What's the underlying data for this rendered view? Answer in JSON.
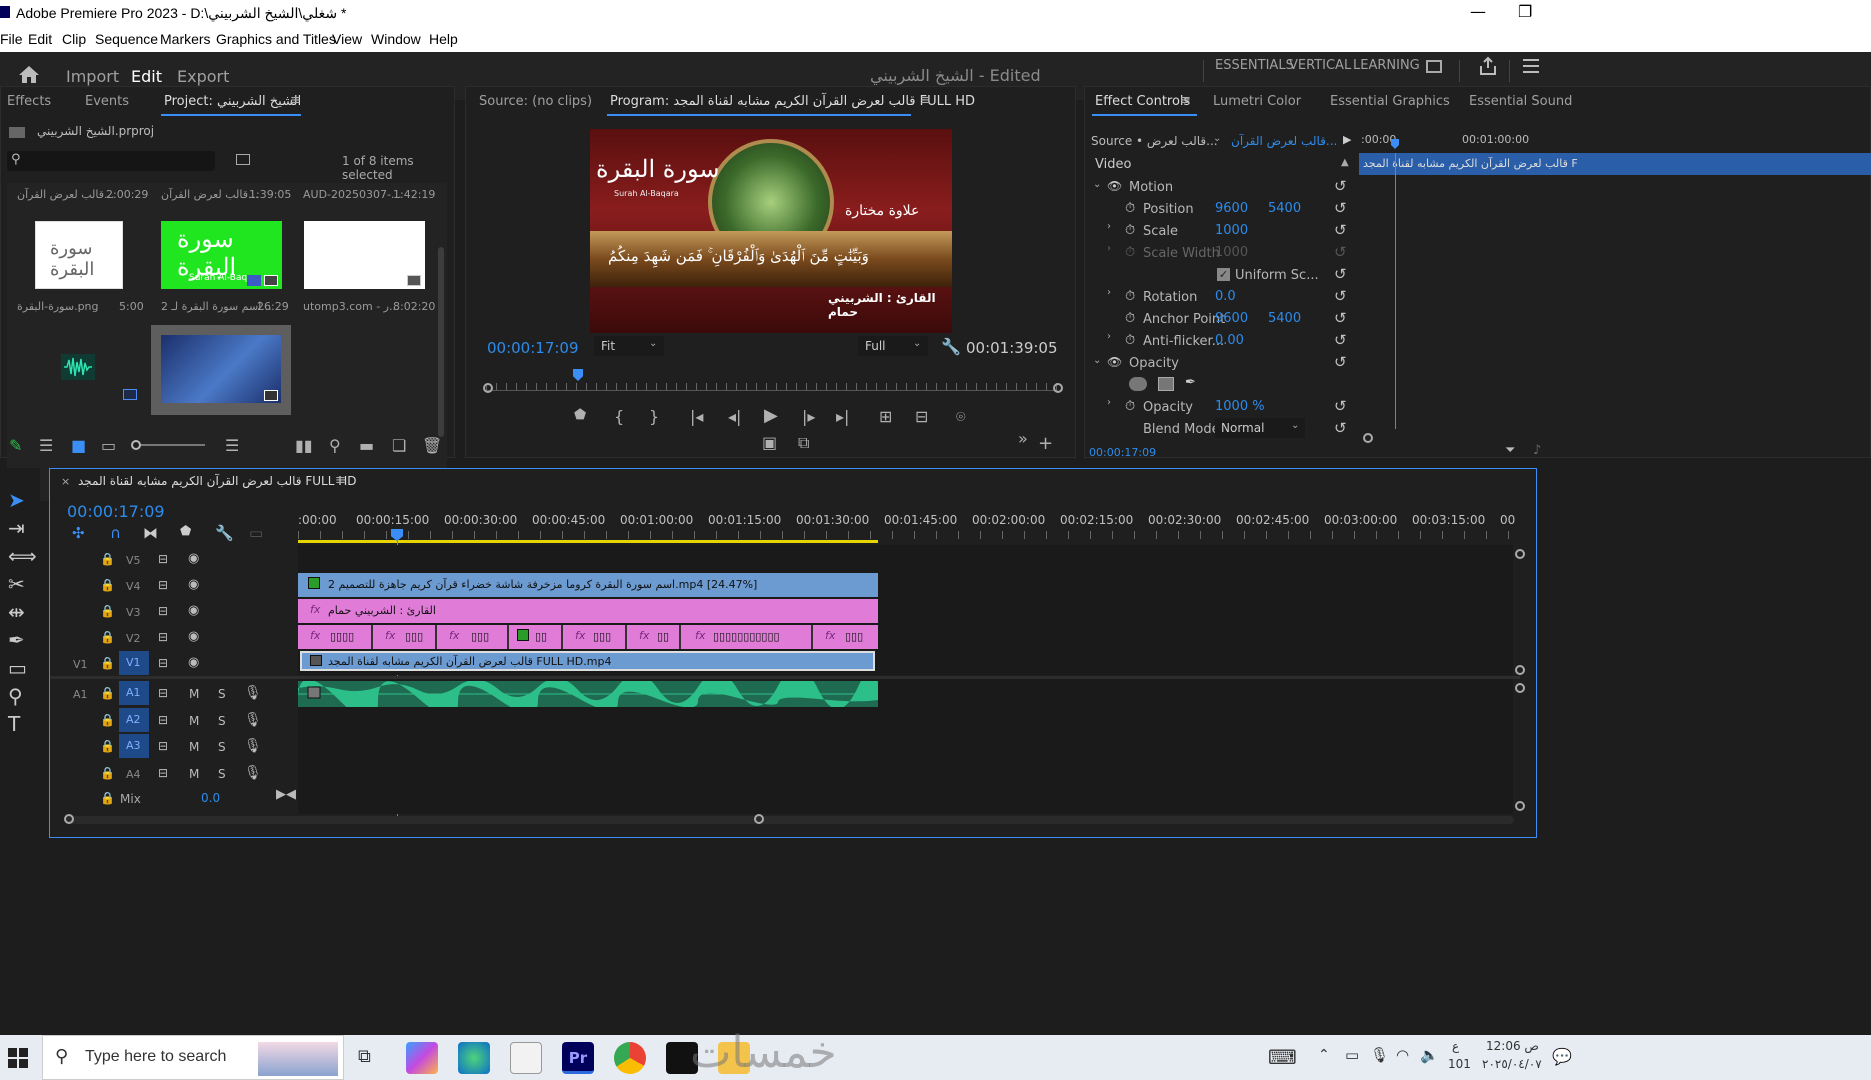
{
  "window": {
    "title": "Adobe Premiere Pro 2023 - D:\\شغلي\\الشيخ الشربيني *",
    "controls": [
      "—",
      "❐"
    ]
  },
  "menu": [
    "File",
    "Edit",
    "Clip",
    "Sequence",
    "Markers",
    "Graphics and Titles",
    "View",
    "Window",
    "Help"
  ],
  "header": {
    "modes": [
      "Import",
      "Edit",
      "Export"
    ],
    "active_mode": "Edit",
    "project_title": "الشيخ الشربيني - Edited",
    "workspaces": [
      "ESSENTIALS",
      "VERTICAL",
      "LEARNING"
    ]
  },
  "project_panel": {
    "tabs": [
      "Effects",
      "Events",
      "Project: الشيخ الشربيني"
    ],
    "file_name": "الشيخ الشربيني.prproj",
    "selection_status": "1 of 8 items selected",
    "items": [
      {
        "name": "قالب لعرض القرآن...",
        "duration": "2:00:29"
      },
      {
        "name": "قالب لعرض القرآن...",
        "duration": "1:39:05"
      },
      {
        "name": "AUD-20250307-...",
        "duration": "1:42:19"
      },
      {
        "name": "سورة-البقرة.png",
        "duration": "5:00"
      },
      {
        "name": "اسم سورة البقرة لـ 2...",
        "duration": "26:29"
      },
      {
        "name": "utomp3.com - ر...",
        "duration": "8:02:20"
      },
      {
        "name": "",
        "duration": ""
      },
      {
        "name": "",
        "duration": ""
      }
    ],
    "thumb_texts": {
      "surah_title": "سورة البقرة",
      "surah_sub": "Surah Al-Baqara"
    }
  },
  "program_monitor": {
    "source_tab": "Source: (no clips)",
    "program_tab": "Program: قالب لعرض القرآن الكريم مشابه لقناة المجد FULL HD",
    "current_time": "00:00:17:09",
    "fit": "Fit",
    "quality": "Full",
    "duration": "00:01:39:05",
    "frame": {
      "surah_title": "سورة البقرة",
      "surah_sub": "Surah Al-Baqara",
      "ayah": "وَبَيِّنَٰتٍ مِّنَ ٱلْهُدَىٰ وَٱلْفُرْقَانِ ۚ فَمَن شَهِدَ مِنكُمُ",
      "reciter": "القارئ : الشربيني حمام",
      "channel": "علاوة مختارة"
    }
  },
  "effect_controls": {
    "tabs": [
      "Effect Controls",
      "Lumetri Color",
      "Essential Graphics",
      "Essential Sound"
    ],
    "source_label": "Source • قالب لعرض...",
    "source_clip": "قالب لعرض القرآن...",
    "timecode_start": ":00:00",
    "timecode_mid": "00:01:00:00",
    "clip_bar": "قالب لعرض القرآن الكريم مشابه لقناة المجد F",
    "section": "Video",
    "motion": "Motion",
    "properties": [
      {
        "label": "Position",
        "v1": "9600",
        "v2": "5400"
      },
      {
        "label": "Scale",
        "v1": "1000",
        "v2": ""
      },
      {
        "label": "Scale Width",
        "v1": "1000",
        "v2": ""
      },
      {
        "label": "Uniform Sc...",
        "v1": "",
        "v2": ""
      },
      {
        "label": "Rotation",
        "v1": "0.0",
        "v2": ""
      },
      {
        "label": "Anchor Point",
        "v1": "9600",
        "v2": "5400"
      },
      {
        "label": "Anti-flicker...",
        "v1": "0.00",
        "v2": ""
      }
    ],
    "opacity_section": "Opacity",
    "opacity_label": "Opacity",
    "opacity_value": "1000 %",
    "blend_label": "Blend Mode",
    "blend_value": "Normal",
    "bottom_time": "00:00:17:09"
  },
  "timeline": {
    "sequence_name": "قالب لعرض القرآن الكريم مشابه لقناة المجد FULL HD",
    "current_time": "00:00:17:09",
    "ruler": [
      ":00:00",
      "00:00:15:00",
      "00:00:30:00",
      "00:00:45:00",
      "00:01:00:00",
      "00:01:15:00",
      "00:01:30:00",
      "00:01:45:00",
      "00:02:00:00",
      "00:02:15:00",
      "00:02:30:00",
      "00:02:45:00",
      "00:03:00:00",
      "00:03:15:00",
      "00"
    ],
    "video_tracks": [
      "V5",
      "V4",
      "V3",
      "V2",
      "V1"
    ],
    "audio_tracks": [
      "A1",
      "A2",
      "A3",
      "A4"
    ],
    "src_v1": "V1",
    "src_a1": "A1",
    "mix_label": "Mix",
    "mix_value": "0.0",
    "clips": {
      "v4": "2 اسم سورة البقرة  كروما  مزخرفة شاشة خضراء قرآن كريم جاهزة للتصميم.mp4 [24.47%]",
      "v3": "القارئ : الشربيني حمام",
      "v2": [
        "▯▯▯▯",
        "▯▯▯",
        "▯▯▯",
        "▯▯",
        "▯▯▯",
        "▯▯",
        "▯▯▯▯▯▯▯▯▯▯▯",
        "▯▯▯"
      ],
      "v1": "قالب لعرض القرآن الكريم مشابه لقناة المجد FULL HD.mp4"
    }
  },
  "taskbar": {
    "search_placeholder": "Type here to search",
    "time": "12:06 ص",
    "date": "٢٠٢٥/٠٤/٠٧",
    "lang": "ع",
    "num": "101",
    "watermark": "خمسات"
  },
  "colors": {
    "accent_blue": "#2d8ceb",
    "v4_clip": "#6c9bd1",
    "v3_clip": "#e07bd8",
    "audio_clip": "#2dbf8a"
  }
}
